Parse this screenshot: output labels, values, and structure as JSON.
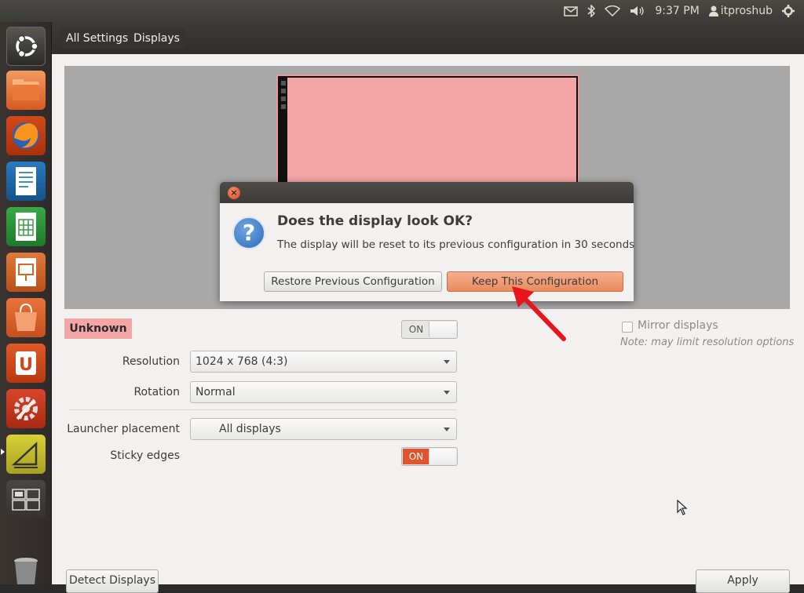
{
  "top_panel": {
    "time": "9:37 PM",
    "user": "itproshub",
    "icons": [
      "mail-icon",
      "bluetooth-icon",
      "wifi-icon",
      "volume-icon",
      "user-icon",
      "gear-icon"
    ]
  },
  "launcher": {
    "items": [
      "ubuntu-dash",
      "files",
      "firefox",
      "libreoffice-writer",
      "libreoffice-calc",
      "libreoffice-impress",
      "software-center",
      "ubuntu-one",
      "system-settings",
      "displays",
      "workspace-switcher",
      "trash"
    ]
  },
  "window": {
    "breadcrumb": {
      "all_settings": "All Settings",
      "current": "Displays"
    }
  },
  "display": {
    "monitor_name": "Unknown",
    "power_toggle": "ON",
    "mirror_label": "Mirror displays",
    "mirror_note": "Note: may limit resolution options",
    "resolution_label": "Resolution",
    "resolution_value": "1024 x 768 (4:3)",
    "rotation_label": "Rotation",
    "rotation_value": "Normal",
    "launcher_placement_label": "Launcher placement",
    "launcher_placement_value": "All displays",
    "sticky_edges_label": "Sticky edges",
    "sticky_edges_toggle": "ON",
    "detect_button": "Detect Displays",
    "apply_button": "Apply"
  },
  "dialog": {
    "title": "Does the display look OK?",
    "message": "The display will be reset to its previous configuration in 30 seconds",
    "restore_button": "Restore Previous Configuration",
    "keep_button": "Keep This Configuration",
    "close_glyph": "×",
    "icon_glyph": "?"
  },
  "colors": {
    "accent_orange": "#e0532f",
    "monitor_pink": "#f4a5a5",
    "keep_button": "#f0a07a",
    "annotation_arrow": "#e8151f"
  }
}
